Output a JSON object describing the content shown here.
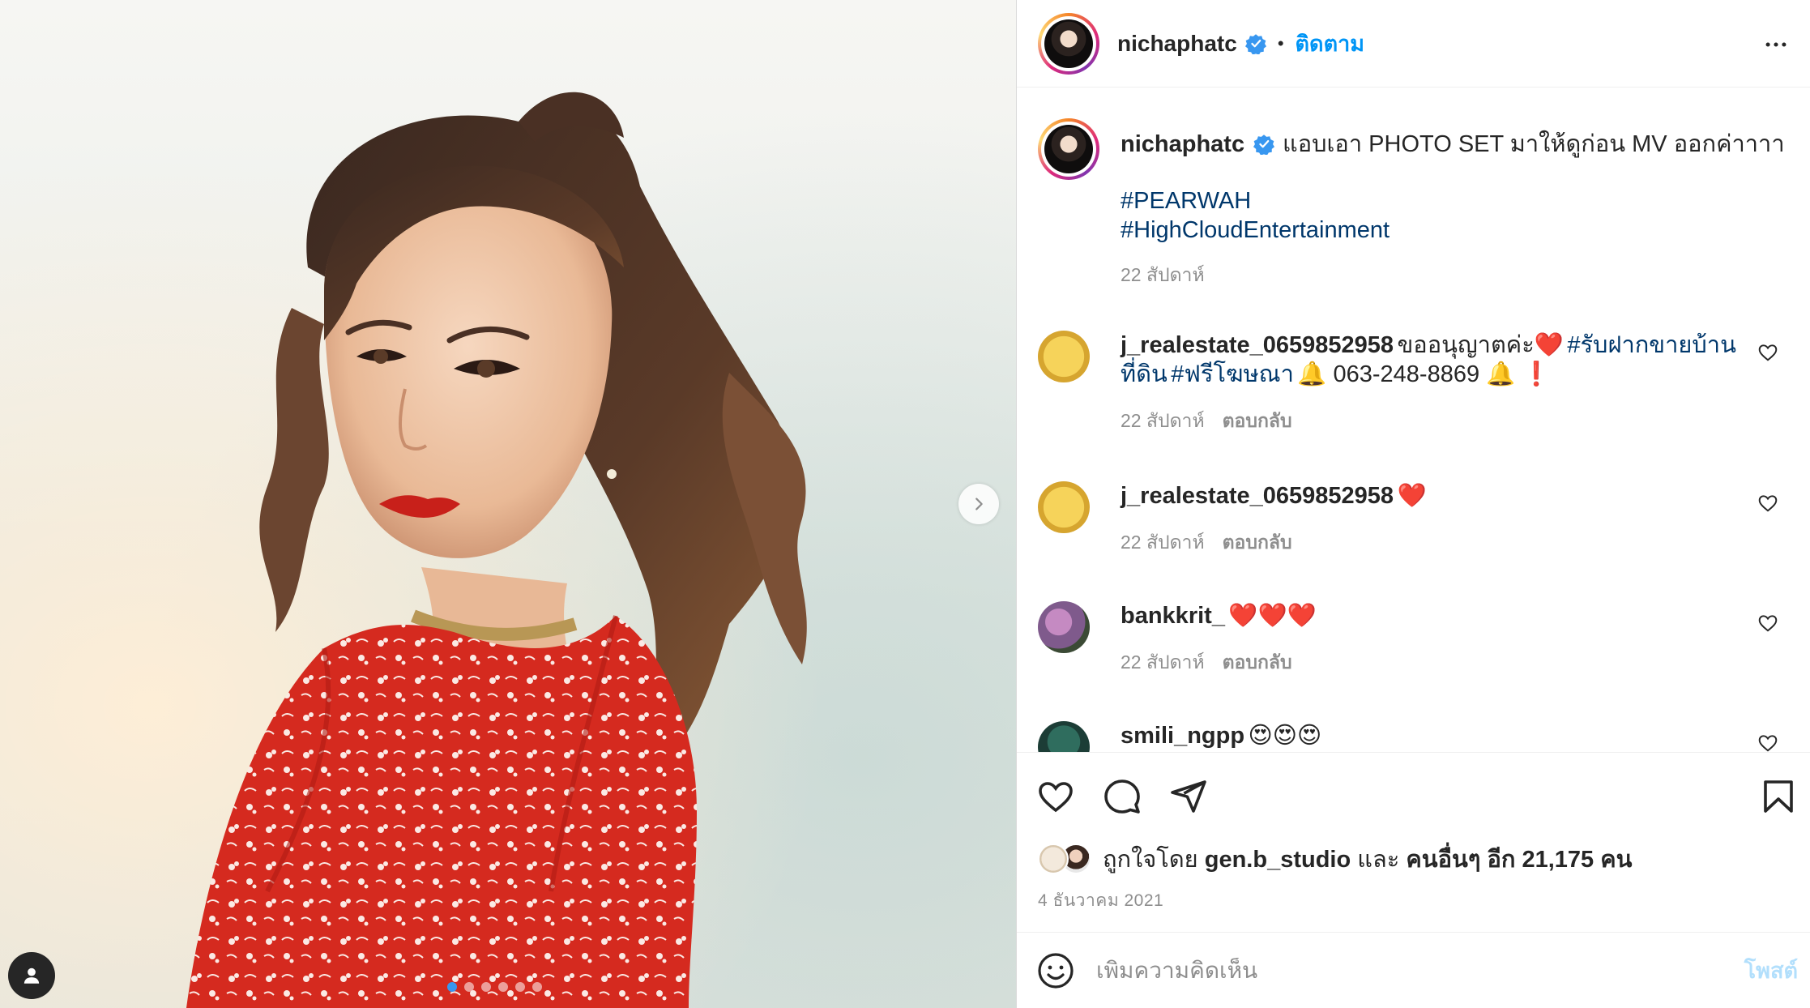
{
  "photo": {
    "next_icon": "chevron-right-icon",
    "tag_icon": "user-icon",
    "dots_total": 6,
    "dots_active": 1
  },
  "header": {
    "username": "nichaphatc",
    "separator": "•",
    "follow_label": "ติดตาม",
    "more_icon": "more-horizontal-icon"
  },
  "caption": {
    "username": "nichaphatc",
    "text": "แอบเอา PHOTO SET มาให้ดูก่อน MV ออกค่าาาา",
    "hashtags": [
      "#PEARWAH",
      "#HighCloudEntertainment"
    ],
    "time": "22 สัปดาห์"
  },
  "comments": [
    {
      "username": "j_realestate_0659852958",
      "text_1": "ขออนุญาตค่ะ❤️",
      "tag_1": "#รับฝากขายบ้าน",
      "line2_tag_a": "ที่ดิน",
      "line2_tag_b": "#ฟรีโฆษณา",
      "line2_text": "🔔 063-248-8869 🔔 ❗",
      "time": "22 สัปดาห์",
      "reply": "ตอบกลับ"
    },
    {
      "username": "j_realestate_0659852958",
      "text": "❤️",
      "time": "22 สัปดาห์",
      "reply": "ตอบกลับ"
    },
    {
      "username": "bankkrit_",
      "text": "❤️❤️❤️",
      "time": "22 สัปดาห์",
      "reply": "ตอบกลับ"
    },
    {
      "username": "smili_ngpp",
      "text": "😍😍😍"
    }
  ],
  "actions": {
    "like_icon": "heart-icon",
    "comment_icon": "comment-icon",
    "share_icon": "send-icon",
    "save_icon": "bookmark-icon"
  },
  "likes": {
    "prefix": "ถูกใจโดย",
    "user": "gen.b_studio",
    "middle": "และ",
    "others": "คนอื่นๆ อีก 21,175 คน"
  },
  "date": "4 ธันวาคม 2021",
  "composer": {
    "placeholder": "เพิ่มความคิดเห็น",
    "post_label": "โพสต์"
  },
  "colors": {
    "accent": "#0095f6",
    "hashtag": "#00376b",
    "muted": "#8e8e8e",
    "verified": "#3897f0"
  }
}
